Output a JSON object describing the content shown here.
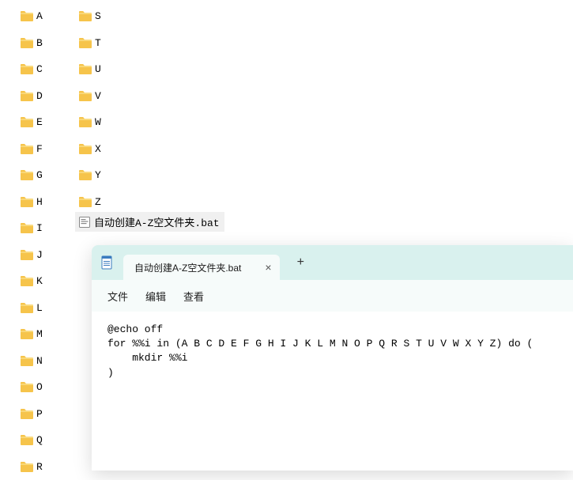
{
  "folders_col1": [
    "A",
    "B",
    "C",
    "D",
    "E",
    "F",
    "G",
    "H",
    "I",
    "J",
    "K",
    "L",
    "M",
    "N",
    "O",
    "P",
    "Q",
    "R"
  ],
  "folders_col2": [
    "S",
    "T",
    "U",
    "V",
    "W",
    "X",
    "Y",
    "Z"
  ],
  "bat_file": {
    "name": "自动创建A-Z空文件夹.bat"
  },
  "editor": {
    "tab_title": "自动创建A-Z空文件夹.bat",
    "tab_close": "×",
    "tab_add": "+",
    "menu": {
      "file": "文件",
      "edit": "编辑",
      "view": "查看"
    },
    "content": "@echo off\nfor %%i in (A B C D E F G H I J K L M N O P Q R S T U V W X Y Z) do (\n    mkdir %%i\n)"
  }
}
